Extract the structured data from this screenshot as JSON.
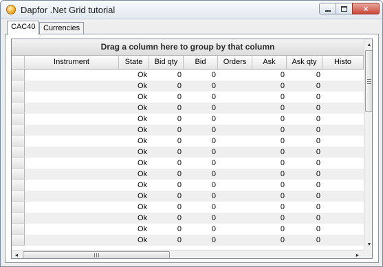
{
  "window": {
    "title": "Dapfor .Net Grid tutorial",
    "icon": "app-icon",
    "buttons": {
      "minimize": "minimize-icon",
      "maximize": "maximize-icon",
      "close": "×"
    }
  },
  "tabs": [
    {
      "label": "CAC40",
      "active": true
    },
    {
      "label": "Currencies",
      "active": false
    }
  ],
  "grid": {
    "group_panel_text": "Drag a column here to group by that column",
    "columns": [
      "Instrument",
      "State",
      "Bid qty",
      "Bid",
      "Orders",
      "Ask",
      "Ask qty",
      "Histo"
    ],
    "rows": [
      [
        "",
        "Ok",
        "0",
        "0",
        "",
        "0",
        "0",
        ""
      ],
      [
        "",
        "Ok",
        "0",
        "0",
        "",
        "0",
        "0",
        ""
      ],
      [
        "",
        "Ok",
        "0",
        "0",
        "",
        "0",
        "0",
        ""
      ],
      [
        "",
        "Ok",
        "0",
        "0",
        "",
        "0",
        "0",
        ""
      ],
      [
        "",
        "Ok",
        "0",
        "0",
        "",
        "0",
        "0",
        ""
      ],
      [
        "",
        "Ok",
        "0",
        "0",
        "",
        "0",
        "0",
        ""
      ],
      [
        "",
        "Ok",
        "0",
        "0",
        "",
        "0",
        "0",
        ""
      ],
      [
        "",
        "Ok",
        "0",
        "0",
        "",
        "0",
        "0",
        ""
      ],
      [
        "",
        "Ok",
        "0",
        "0",
        "",
        "0",
        "0",
        ""
      ],
      [
        "",
        "Ok",
        "0",
        "0",
        "",
        "0",
        "0",
        ""
      ],
      [
        "",
        "Ok",
        "0",
        "0",
        "",
        "0",
        "0",
        ""
      ],
      [
        "",
        "Ok",
        "0",
        "0",
        "",
        "0",
        "0",
        ""
      ],
      [
        "",
        "Ok",
        "0",
        "0",
        "",
        "0",
        "0",
        ""
      ],
      [
        "",
        "Ok",
        "0",
        "0",
        "",
        "0",
        "0",
        ""
      ],
      [
        "",
        "Ok",
        "0",
        "0",
        "",
        "0",
        "0",
        ""
      ],
      [
        "",
        "Ok",
        "0",
        "0",
        "",
        "0",
        "0",
        ""
      ]
    ]
  },
  "scrollbars": {
    "up_arrow": "▲",
    "down_arrow": "▼",
    "left_arrow": "◄",
    "right_arrow": "►",
    "h_thumb_grip": "grip-icon",
    "v_thumb_grip": "grip-icon"
  },
  "colors": {
    "alt_row": "#efefef",
    "close_button": "#c8473a"
  }
}
